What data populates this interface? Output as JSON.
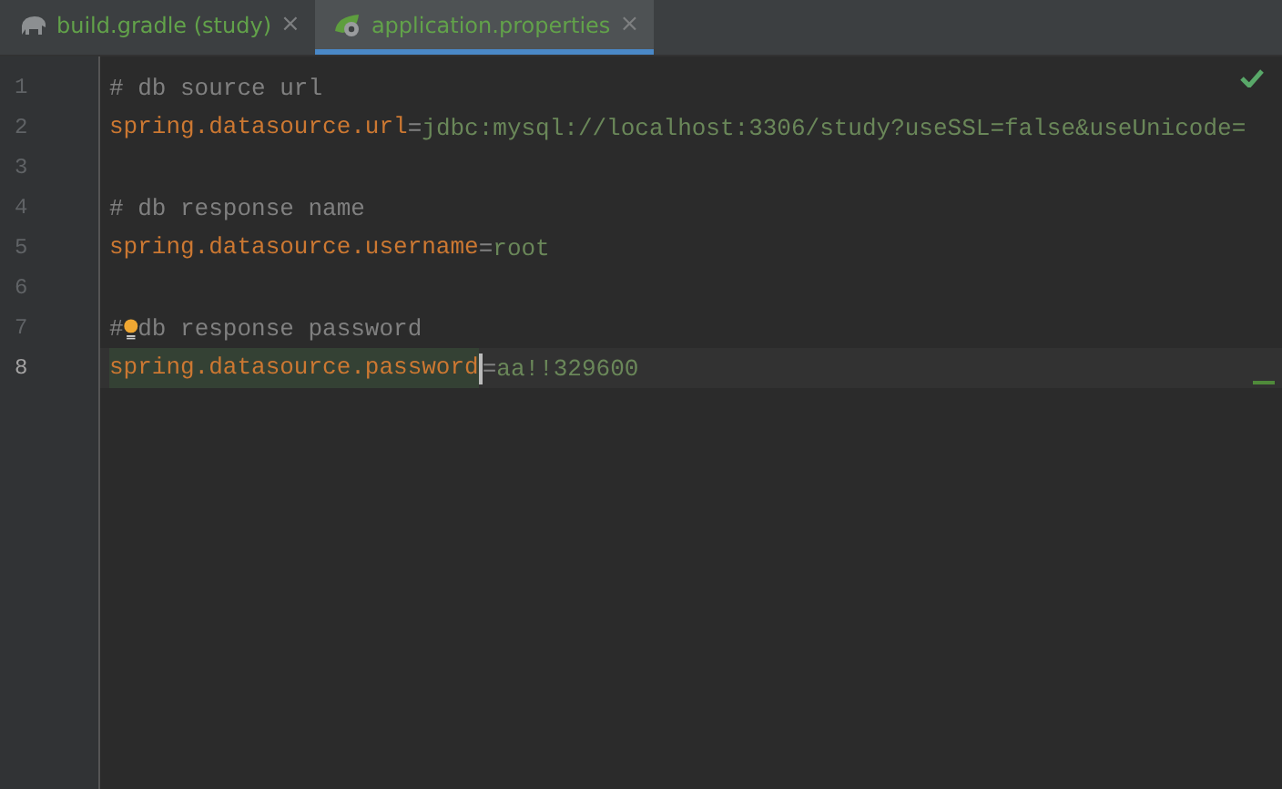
{
  "tabs": [
    {
      "label": "build.gradle (study)",
      "kind": "gradle",
      "close": "×",
      "selected": false
    },
    {
      "label": "application.properties",
      "kind": "properties",
      "close": "×",
      "selected": true
    }
  ],
  "editor": {
    "inspection_ok": true,
    "lines": [
      {
        "number": "1",
        "kind": "comment",
        "text": "# db source url",
        "current": false
      },
      {
        "number": "2",
        "kind": "property",
        "key": "spring.datasource.url",
        "sep": "=",
        "value": "jdbc:mysql://localhost:3306/study?useSSL=false&useUnicode=",
        "current": false
      },
      {
        "number": "3",
        "kind": "blank",
        "current": false
      },
      {
        "number": "4",
        "kind": "comment",
        "text": "# db response name",
        "current": false
      },
      {
        "number": "5",
        "kind": "property",
        "key": "spring.datasource.username",
        "sep": "=",
        "value": "root",
        "current": false
      },
      {
        "number": "6",
        "kind": "blank",
        "current": false
      },
      {
        "number": "7",
        "kind": "bulb_comment",
        "prefix": "#",
        "text": "db response password",
        "current": false
      },
      {
        "number": "8",
        "kind": "property",
        "key": "spring.datasource.password",
        "sep": "=",
        "value": "aa!!329600",
        "current": true,
        "key_highlight": true,
        "caret": true
      }
    ]
  }
}
